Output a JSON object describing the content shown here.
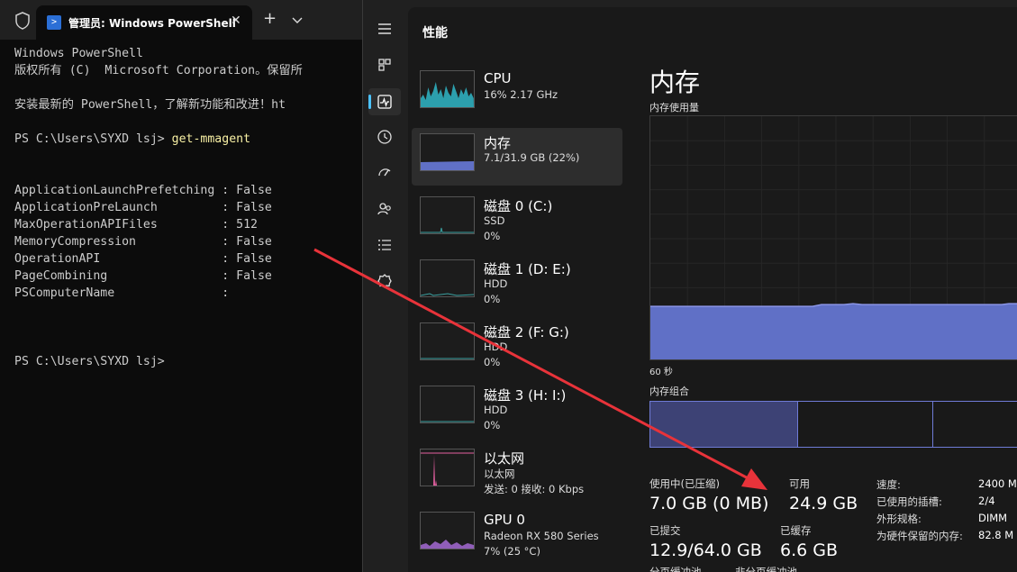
{
  "terminal": {
    "tab_title": "管理员: Windows PowerShell",
    "tab_close": "✕",
    "tab_add": "+",
    "lines": [
      {
        "text": "Windows PowerShell"
      },
      {
        "text": "版权所有 (C)  Microsoft Corporation。保留所"
      },
      {
        "text": ""
      },
      {
        "text": "安装最新的 PowerShell，了解新功能和改进！ht"
      },
      {
        "text": ""
      },
      {
        "text": "PS C:\\Users\\SYXD lsj> ",
        "cmd": "get-mmagent"
      },
      {
        "text": ""
      },
      {
        "text": ""
      },
      {
        "text": "ApplicationLaunchPrefetching : False"
      },
      {
        "text": "ApplicationPreLaunch         : False"
      },
      {
        "text": "MaxOperationAPIFiles         : 512"
      },
      {
        "text": "MemoryCompression            : False"
      },
      {
        "text": "OperationAPI                 : False"
      },
      {
        "text": "PageCombining                : False"
      },
      {
        "text": "PSComputerName               :"
      },
      {
        "text": ""
      },
      {
        "text": ""
      },
      {
        "text": ""
      },
      {
        "text": "PS C:\\Users\\SYXD lsj>"
      }
    ]
  },
  "taskmgr": {
    "title": "性能",
    "nav_icons": [
      "hamburger-icon",
      "processes-icon",
      "performance-icon",
      "app-history-icon",
      "startup-apps-icon",
      "users-icon",
      "details-icon",
      "services-icon"
    ],
    "sidebar": [
      {
        "name": "CPU",
        "sub1": "16%  2.17 GHz",
        "sub2": ""
      },
      {
        "name": "内存",
        "sub1": "7.1/31.9 GB (22%)",
        "sub2": ""
      },
      {
        "name": "磁盘 0 (C:)",
        "sub1": "SSD",
        "sub2": "0%"
      },
      {
        "name": "磁盘 1 (D: E:)",
        "sub1": "HDD",
        "sub2": "0%"
      },
      {
        "name": "磁盘 2 (F: G:)",
        "sub1": "HDD",
        "sub2": "0%"
      },
      {
        "name": "磁盘 3 (H: I:)",
        "sub1": "HDD",
        "sub2": "0%"
      },
      {
        "name": "以太网",
        "sub1": "以太网",
        "sub2": "发送: 0 接收: 0 Kbps"
      },
      {
        "name": "GPU 0",
        "sub1": "Radeon RX 580 Series",
        "sub2": "7% (25 °C)"
      }
    ],
    "detail": {
      "heading": "内存",
      "usage_label": "内存使用量",
      "graph_time": "60 秒",
      "composition_label": "内存组合",
      "in_use_label": "使用中(已压缩)",
      "in_use_value": "7.0 GB (0 MB)",
      "available_label": "可用",
      "available_value": "24.9 GB",
      "committed_label": "已提交",
      "committed_value": "12.9/64.0 GB",
      "cached_label": "已缓存",
      "cached_value": "6.6 GB",
      "paged_pool_label": "分页缓冲池",
      "nonpaged_pool_label": "非分页缓冲池",
      "specs": [
        {
          "key": "速度:",
          "value": "2400 M"
        },
        {
          "key": "已使用的插槽:",
          "value": "2/4"
        },
        {
          "key": "外形规格:",
          "value": "DIMM"
        },
        {
          "key": "为硬件保留的内存:",
          "value": "82.8 M"
        }
      ],
      "usage_fraction": 0.22
    },
    "colors": {
      "memory_fill": "#6070c6",
      "memory_line": "#8a95e6",
      "cpu": "#2fb6c7",
      "ethernet": "#e35fa0",
      "gpu": "#a46ad3",
      "arrow": "#e8333a"
    }
  }
}
